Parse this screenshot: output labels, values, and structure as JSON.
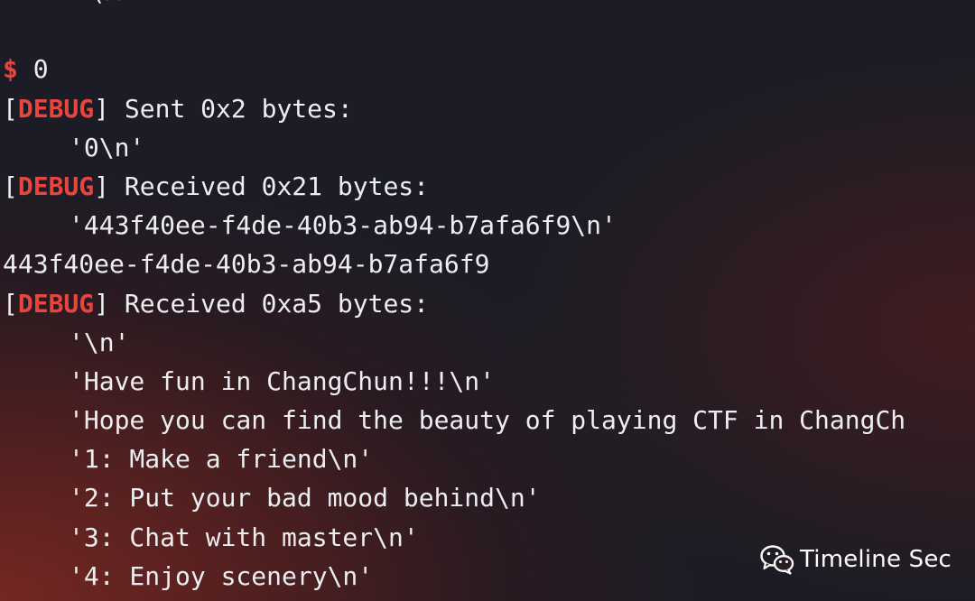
{
  "terminal": {
    "partial_line": "(X",
    "prompt_symbol": "$",
    "command": "0",
    "debug_tag": "DEBUG",
    "lines": {
      "sent_header": "Sent 0x2 bytes:",
      "sent_payload": "'0\\n'",
      "recv1_header": "Received 0x21 bytes:",
      "recv1_payload": "'443f40ee-f4de-40b3-ab94-b7afa6f9\\n'",
      "output_uuid": "443f40ee-f4de-40b3-ab94-b7afa6f9",
      "recv2_header": "Received 0xa5 bytes:",
      "recv2_lines": [
        "'\\n'",
        "'Have fun in ChangChun!!!\\n'",
        "'Hope you can find the beauty of playing CTF in ChangCh",
        "'1: Make a friend\\n'",
        "'2: Put your bad mood behind\\n'",
        "'3: Chat with master\\n'",
        "'4: Enjoy scenery\\n'"
      ]
    }
  },
  "watermark": {
    "icon": "wechat-icon",
    "text": "Timeline Sec"
  },
  "colors": {
    "background": "#1b1c25",
    "text": "#eceef2",
    "debug_red": "#e8453f"
  }
}
